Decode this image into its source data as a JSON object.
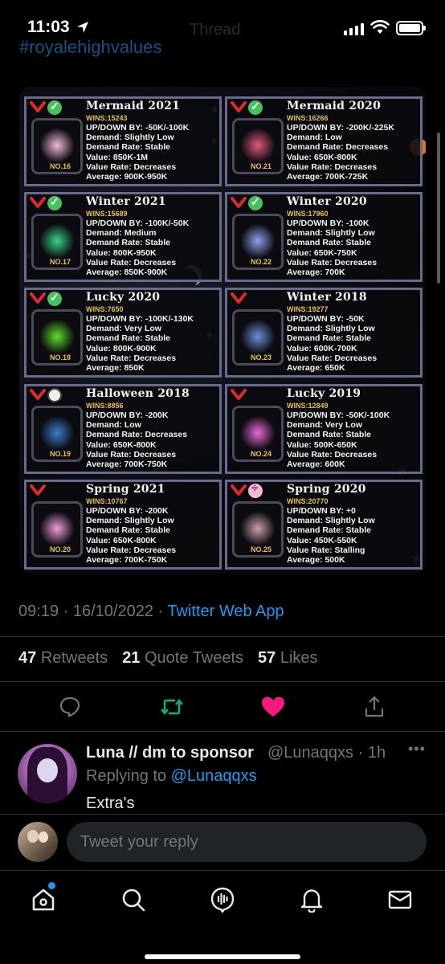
{
  "status_bar": {
    "time": "11:03"
  },
  "header": {
    "ghost_title": "Thread",
    "cut_text": "#royalehighvalues"
  },
  "media": {
    "cards": [
      {
        "title": "Mermaid 2021",
        "wins": "WINS:15243",
        "no": "NO.16",
        "badge": "green",
        "lines": [
          "UP/DOWN BY: -50K/-100K",
          "Demand: Slightly Low",
          "Demand Rate: Stable",
          "Value: 850K-1M",
          "Value Rate: Decreases",
          "Average: 900K-950K"
        ],
        "glow": "#f2b8d8"
      },
      {
        "title": "Mermaid 2020",
        "wins": "WINS:16266",
        "no": "NO.21",
        "badge": "green",
        "lines": [
          "UP/DOWN BY: -200K/-225K",
          "Demand: Low",
          "Demand Rate: Decreases",
          "Value: 650K-800K",
          "Value Rate: Decreases",
          "Average: 700K-725K"
        ],
        "glow": "#e2597e"
      },
      {
        "title": "Winter 2021",
        "wins": "WINS:15689",
        "no": "NO.17",
        "badge": "green",
        "lines": [
          "UP/DOWN BY: -100K/-50K",
          "Demand: Medium",
          "Demand Rate: Stable",
          "Value: 800K-950K",
          "Value Rate: Decreases",
          "Average: 850K-900K"
        ],
        "glow": "#38d38a"
      },
      {
        "title": "Winter 2020",
        "wins": "WINS:17960",
        "no": "NO.22",
        "badge": "green",
        "lines": [
          "UP/DOWN BY: -100K",
          "Demand: Slightly Low",
          "Demand Rate: Stable",
          "Value: 650K-750K",
          "Value Rate: Decreases",
          "Average: 700K"
        ],
        "glow": "#8fa0ef"
      },
      {
        "title": "Lucky 2020",
        "wins": "WINS:7650",
        "no": "NO.18",
        "badge": "green",
        "lines": [
          "UP/DOWN BY: -100K/-130K",
          "Demand: Very Low",
          "Demand Rate: Stable",
          "Value: 800K-900K",
          "Value Rate: Decreases",
          "Average: 850K"
        ],
        "glow": "#5ee02a"
      },
      {
        "title": "Winter 2018",
        "wins": "WINS:19277",
        "no": "NO.23",
        "badge": "none",
        "lines": [
          "UP/DOWN BY: -50K",
          "Demand: Slightly Low",
          "Demand Rate: Stable",
          "Value: 600K-700K",
          "Value Rate: Decreases",
          "Average: 650K"
        ],
        "glow": "#6f8fd6"
      },
      {
        "title": "Halloween 2018",
        "wins": "WINS:8856",
        "no": "NO.19",
        "badge": "mixed",
        "lines": [
          "UP/DOWN BY: -200K",
          "Demand: Low",
          "Demand Rate: Decreases",
          "Value: 650K-800K",
          "Value Rate: Decreases",
          "Average: 700K-750K"
        ],
        "glow": "#3b7fc8"
      },
      {
        "title": "Lucky 2019",
        "wins": "WINS:12849",
        "no": "NO.24",
        "badge": "none",
        "lines": [
          "UP/DOWN BY: -50K/-100K",
          "Demand: Very Low",
          "Demand Rate: Stable",
          "Value: 500K-650K",
          "Value Rate: Decreases",
          "Average: 600K"
        ],
        "glow": "#e86ad6"
      },
      {
        "title": "Spring 2021",
        "wins": "WINS:10767",
        "no": "NO.20",
        "badge": "none",
        "lines": [
          "UP/DOWN BY: -200K",
          "Demand: Slightly Low",
          "Demand Rate: Stable",
          "Value: 650K-800K",
          "Value Rate: Decreases",
          "Average: 700K-750K"
        ],
        "glow": "#f29bd8"
      },
      {
        "title": "Spring 2020",
        "wins": "WINS:20770",
        "no": "NO.25",
        "badge": "pink",
        "lines": [
          "UP/DOWN BY: +0",
          "Demand: Slightly Low",
          "Demand Rate: Stable",
          "Value: 450K-550K",
          "Value Rate: Stalling",
          "Average: 500K"
        ],
        "glow": "#c9a0a8"
      }
    ]
  },
  "tweet_meta": {
    "time": "09:19",
    "date": "16/10/2022",
    "app": "Twitter Web App"
  },
  "counts": {
    "retweets_num": "47",
    "retweets_label": "Retweets",
    "quotes_num": "21",
    "quotes_label": "Quote Tweets",
    "likes_num": "57",
    "likes_label": "Likes"
  },
  "actions": {
    "reply_icon": "reply-icon",
    "retweet_icon": "retweet-icon",
    "like_icon": "heart-icon",
    "share_icon": "share-icon",
    "colors": {
      "retweet": "#00ba7c",
      "like": "#f91880",
      "muted": "#71767b"
    }
  },
  "reply": {
    "name": "Luna // dm to sponsor",
    "handle": "@Lunaqqxs · 1h",
    "replying_prefix": "Replying to",
    "replying_handle": "@Lunaqqxs",
    "text": "Extra's"
  },
  "compose": {
    "placeholder": "Tweet your reply"
  },
  "tabbar": {
    "items": [
      "home-icon",
      "search-icon",
      "spaces-icon",
      "notifications-icon",
      "messages-icon"
    ]
  },
  "colors": {
    "accent": "#1d9bf0",
    "background": "#000000",
    "text": "#e7e9ea",
    "muted": "#71767b"
  }
}
